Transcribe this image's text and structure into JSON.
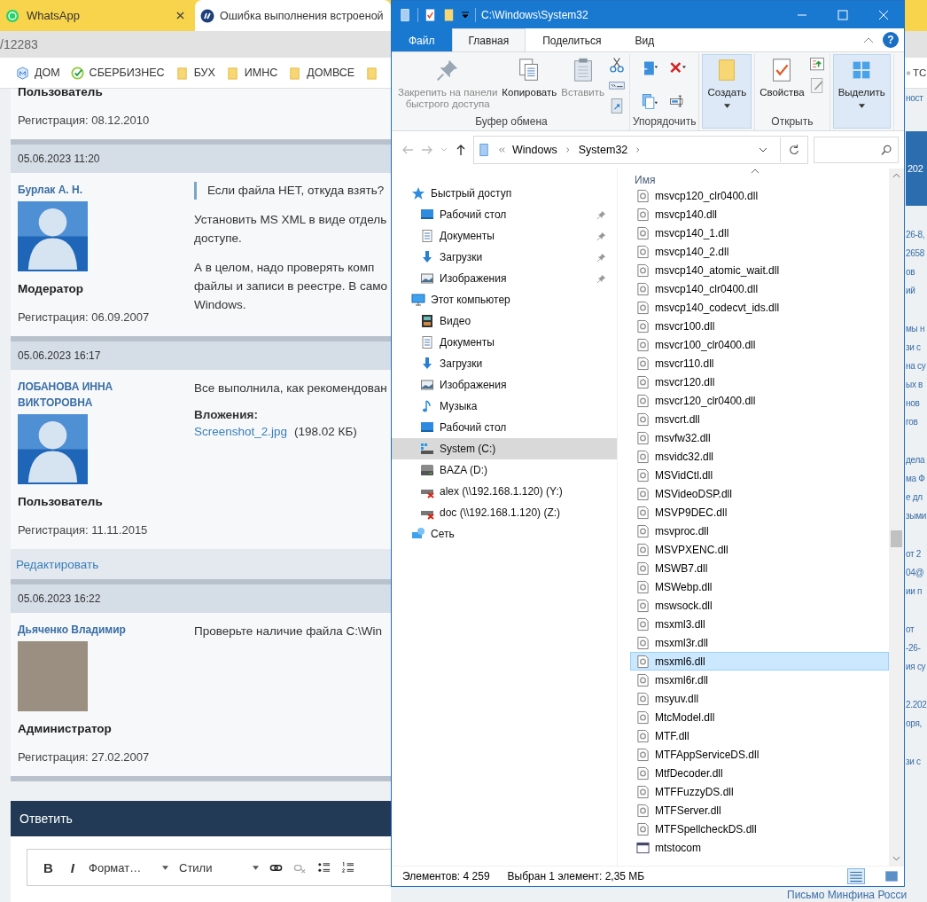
{
  "browser": {
    "tabs": [
      {
        "title": "WhatsApp",
        "kind": "whatsapp",
        "selected": false,
        "closable": true
      },
      {
        "title": "Ошибка выполнения встроеной",
        "kind": "site",
        "selected": true,
        "closable": false
      }
    ],
    "address": "/12283",
    "bookmarks": [
      {
        "label": "ДОМ",
        "kind": "m"
      },
      {
        "label": "СБЕРБИЗНЕС",
        "kind": "sber"
      },
      {
        "label": "БУХ",
        "kind": "folder"
      },
      {
        "label": "ИМНС",
        "kind": "folder"
      },
      {
        "label": "ДОМВСЕ",
        "kind": "folder"
      },
      {
        "label": "ТС",
        "kind": "circle"
      }
    ]
  },
  "forum": {
    "posts": [
      {
        "role": "Пользователь",
        "registration": "Регистрация: 08.12.2010"
      },
      {
        "date": "05.06.2023 11:20",
        "author": "Бурлак А. Н.",
        "avatar": {
          "kind": "silhouette"
        },
        "role": "Модератор",
        "registration": "Регистрация: 06.09.2007",
        "body": [
          {
            "kind": "quote",
            "text": "Если файла НЕТ, откуда взять?"
          },
          {
            "kind": "text",
            "text": "Установить MS XML в виде отдель\nдоступе."
          },
          {
            "kind": "text",
            "text": "А в целом, надо проверять комп\nфайлы и записи в реестре. В само\nWindows."
          }
        ]
      },
      {
        "date": "05.06.2023 16:17",
        "author": "ЛОБАНОВА ИННА ВИКТОРОВНА",
        "avatar": {
          "kind": "silhouette"
        },
        "role": "Пользователь",
        "registration": "Регистрация: 11.11.2015",
        "body": [
          {
            "kind": "text",
            "text": "Все выполнила, как рекомендован"
          },
          {
            "kind": "attachment",
            "heading": "Вложения:",
            "link": "Screenshot_2.jpg",
            "size": "(198.02 КБ)"
          }
        ],
        "edit_link": "Редактировать"
      },
      {
        "date": "05.06.2023 16:22",
        "author": "Дьяченко Владимир",
        "avatar": {
          "kind": "photo"
        },
        "role": "Администратор",
        "registration": "Регистрация: 27.02.2007",
        "body": [
          {
            "kind": "text",
            "text": "Проверьте наличие файла C:\\Win"
          }
        ]
      }
    ],
    "reply": {
      "title": "Ответить",
      "toolbar": [
        {
          "kind": "bold",
          "label": "B"
        },
        {
          "kind": "italic",
          "label": "I"
        },
        {
          "kind": "select",
          "label": "Формат…"
        },
        {
          "kind": "select",
          "label": "Стили"
        },
        {
          "kind": "link"
        },
        {
          "kind": "unlink"
        },
        {
          "kind": "bullets"
        },
        {
          "kind": "numbers"
        }
      ]
    },
    "side_fragments": {
      "top": "ност",
      "banner": "202",
      "groups": [
        [
          "26-8,",
          "2658",
          "ов",
          "ий"
        ],
        [
          "мы н",
          "зи с",
          "на су",
          "ых в",
          "нов",
          "гов"
        ],
        [
          "дела",
          "ма Ф",
          "е дл",
          "зыми"
        ],
        [
          "от 2",
          "04@",
          "ии п"
        ],
        [
          "от",
          "-26-",
          "ия су"
        ],
        [
          "2.202",
          "оря,"
        ],
        [
          "зи с"
        ]
      ],
      "bottom": "Письмо Минфина Росси"
    }
  },
  "explorer": {
    "title": "C:\\Windows\\System32",
    "ribbon_tabs": [
      {
        "label": "Файл",
        "kind": "file",
        "selected": false
      },
      {
        "label": "Главная",
        "kind": "tab",
        "selected": true
      },
      {
        "label": "Поделиться",
        "kind": "tab",
        "selected": false
      },
      {
        "label": "Вид",
        "kind": "tab",
        "selected": false
      }
    ],
    "help": "?",
    "ribbon_groups": [
      {
        "label": "Буфер обмена",
        "large": [
          {
            "kind": "pin",
            "label": "Закрепить на панели\nбыстрого доступа",
            "disabled": true,
            "highlighted": false
          },
          {
            "kind": "copy",
            "label": "Копировать",
            "disabled": false,
            "highlighted": false
          },
          {
            "kind": "paste",
            "label": "Вставить",
            "disabled": true,
            "highlighted": false
          }
        ],
        "small": [
          {
            "kind": "cut"
          },
          {
            "kind": "copy-path"
          },
          {
            "kind": "paste-shortcut"
          }
        ]
      },
      {
        "label": "Упорядочить",
        "small": [
          {
            "kind": "move-to"
          },
          {
            "kind": "delete"
          },
          {
            "kind": "copy-to"
          },
          {
            "kind": "rename"
          }
        ]
      },
      {
        "large": [
          {
            "kind": "new-folder",
            "label": "Создать",
            "disabled": false,
            "highlighted": true
          }
        ]
      },
      {
        "label": "Открыть",
        "large": [
          {
            "kind": "properties",
            "label": "Свойства",
            "disabled": false,
            "highlighted": false
          }
        ],
        "small": [
          {
            "kind": "open"
          },
          {
            "kind": "edit"
          }
        ]
      },
      {
        "large": [
          {
            "kind": "select",
            "label": "Выделить",
            "disabled": false,
            "highlighted": true
          }
        ]
      }
    ],
    "path": [
      "Windows",
      "System32"
    ],
    "nav": [
      {
        "label": "Быстрый доступ",
        "kind": "star",
        "selected": false,
        "children": [
          {
            "label": "Рабочий стол",
            "kind": "desktop",
            "selected": false,
            "pinned": true
          },
          {
            "label": "Документы",
            "kind": "docs",
            "selected": false,
            "pinned": true
          },
          {
            "label": "Загрузки",
            "kind": "download",
            "selected": false,
            "pinned": true
          },
          {
            "label": "Изображения",
            "kind": "pictures",
            "selected": false,
            "pinned": true
          }
        ]
      },
      {
        "label": "Этот компьютер",
        "kind": "pc",
        "selected": false,
        "children": [
          {
            "label": "Видео",
            "kind": "video",
            "selected": false,
            "pinned": false
          },
          {
            "label": "Документы",
            "kind": "docs",
            "selected": false,
            "pinned": false
          },
          {
            "label": "Загрузки",
            "kind": "download",
            "selected": false,
            "pinned": false
          },
          {
            "label": "Изображения",
            "kind": "pictures",
            "selected": false,
            "pinned": false
          },
          {
            "label": "Музыка",
            "kind": "music",
            "selected": false,
            "pinned": false
          },
          {
            "label": "Рабочий стол",
            "kind": "desktop",
            "selected": false,
            "pinned": false
          },
          {
            "label": "System (C:)",
            "kind": "drive-system",
            "selected": true,
            "pinned": false
          },
          {
            "label": "BAZA (D:)",
            "kind": "drive",
            "selected": false,
            "pinned": false
          },
          {
            "label": "alex (\\\\192.168.1.120) (Y:)",
            "kind": "netdrive-off",
            "selected": false,
            "pinned": false
          },
          {
            "label": "doc (\\\\192.168.1.120) (Z:)",
            "kind": "netdrive-off",
            "selected": false,
            "pinned": false
          }
        ]
      },
      {
        "label": "Сеть",
        "kind": "network",
        "selected": false
      }
    ],
    "column": "Имя",
    "files": [
      {
        "name": "msvcp120_clr0400.dll",
        "kind": "dll",
        "selected": false
      },
      {
        "name": "msvcp140.dll",
        "kind": "dll",
        "selected": false
      },
      {
        "name": "msvcp140_1.dll",
        "kind": "dll",
        "selected": false
      },
      {
        "name": "msvcp140_2.dll",
        "kind": "dll",
        "selected": false
      },
      {
        "name": "msvcp140_atomic_wait.dll",
        "kind": "dll",
        "selected": false
      },
      {
        "name": "msvcp140_clr0400.dll",
        "kind": "dll",
        "selected": false
      },
      {
        "name": "msvcp140_codecvt_ids.dll",
        "kind": "dll",
        "selected": false
      },
      {
        "name": "msvcr100.dll",
        "kind": "dll",
        "selected": false
      },
      {
        "name": "msvcr100_clr0400.dll",
        "kind": "dll",
        "selected": false
      },
      {
        "name": "msvcr110.dll",
        "kind": "dll",
        "selected": false
      },
      {
        "name": "msvcr120.dll",
        "kind": "dll",
        "selected": false
      },
      {
        "name": "msvcr120_clr0400.dll",
        "kind": "dll",
        "selected": false
      },
      {
        "name": "msvcrt.dll",
        "kind": "dll",
        "selected": false
      },
      {
        "name": "msvfw32.dll",
        "kind": "dll",
        "selected": false
      },
      {
        "name": "msvidc32.dll",
        "kind": "dll",
        "selected": false
      },
      {
        "name": "MSVidCtl.dll",
        "kind": "dll",
        "selected": false
      },
      {
        "name": "MSVideoDSP.dll",
        "kind": "dll",
        "selected": false
      },
      {
        "name": "MSVP9DEC.dll",
        "kind": "dll",
        "selected": false
      },
      {
        "name": "msvproc.dll",
        "kind": "dll",
        "selected": false
      },
      {
        "name": "MSVPXENC.dll",
        "kind": "dll",
        "selected": false
      },
      {
        "name": "MSWB7.dll",
        "kind": "dll",
        "selected": false
      },
      {
        "name": "MSWebp.dll",
        "kind": "dll",
        "selected": false
      },
      {
        "name": "mswsock.dll",
        "kind": "dll",
        "selected": false
      },
      {
        "name": "msxml3.dll",
        "kind": "dll",
        "selected": false
      },
      {
        "name": "msxml3r.dll",
        "kind": "dll",
        "selected": false
      },
      {
        "name": "msxml6.dll",
        "kind": "dll",
        "selected": true
      },
      {
        "name": "msxml6r.dll",
        "kind": "dll",
        "selected": false
      },
      {
        "name": "msyuv.dll",
        "kind": "dll",
        "selected": false
      },
      {
        "name": "MtcModel.dll",
        "kind": "dll",
        "selected": false
      },
      {
        "name": "MTF.dll",
        "kind": "dll",
        "selected": false
      },
      {
        "name": "MTFAppServiceDS.dll",
        "kind": "dll",
        "selected": false
      },
      {
        "name": "MtfDecoder.dll",
        "kind": "dll",
        "selected": false
      },
      {
        "name": "MTFFuzzyDS.dll",
        "kind": "dll",
        "selected": false
      },
      {
        "name": "MTFServer.dll",
        "kind": "dll",
        "selected": false
      },
      {
        "name": "MTFSpellcheckDS.dll",
        "kind": "dll",
        "selected": false
      },
      {
        "name": "mtstocom",
        "kind": "app",
        "selected": false
      }
    ],
    "status": {
      "count": "Элементов: 4 259",
      "selection": "Выбран 1 элемент: 2,35 МБ"
    },
    "views": [
      {
        "kind": "details",
        "selected": true
      },
      {
        "kind": "large-icons",
        "selected": false
      }
    ]
  }
}
